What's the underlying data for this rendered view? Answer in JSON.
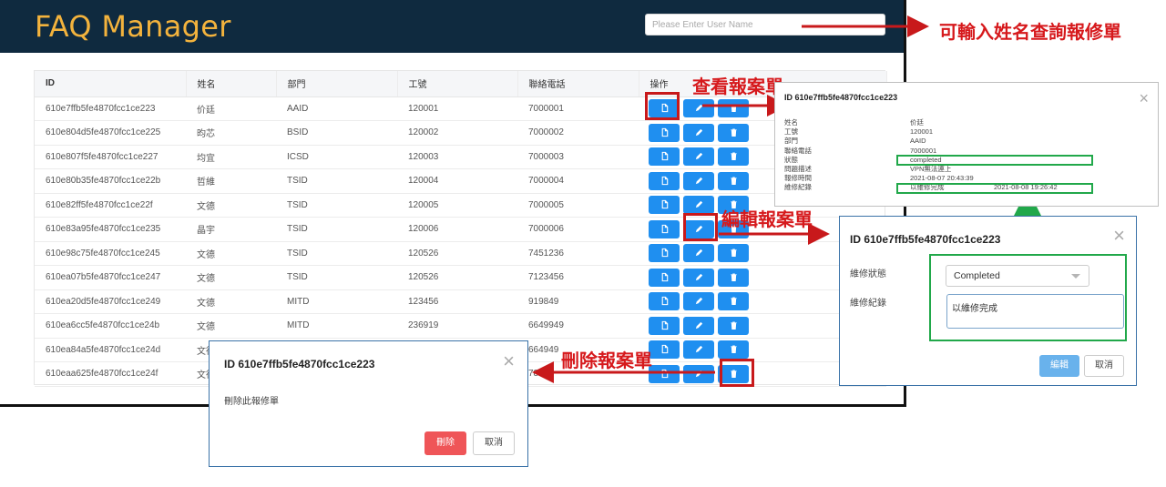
{
  "app": {
    "title": "FAQ Manager"
  },
  "search": {
    "placeholder": "Please Enter User Name"
  },
  "table": {
    "headers": [
      "ID",
      "姓名",
      "部門",
      "工號",
      "聯絡電話",
      "操作"
    ],
    "rows": [
      {
        "id": "610e7ffb5fe4870fcc1ce223",
        "name": "价廷",
        "dept": "AAID",
        "emp_no": "120001",
        "phone": "7000001"
      },
      {
        "id": "610e804d5fe4870fcc1ce225",
        "name": "昀芯",
        "dept": "BSID",
        "emp_no": "120002",
        "phone": "7000002"
      },
      {
        "id": "610e807f5fe4870fcc1ce227",
        "name": "均宜",
        "dept": "ICSD",
        "emp_no": "120003",
        "phone": "7000003"
      },
      {
        "id": "610e80b35fe4870fcc1ce22b",
        "name": "哲維",
        "dept": "TSID",
        "emp_no": "120004",
        "phone": "7000004"
      },
      {
        "id": "610e82ff5fe4870fcc1ce22f",
        "name": "文德",
        "dept": "TSID",
        "emp_no": "120005",
        "phone": "7000005"
      },
      {
        "id": "610e83a95fe4870fcc1ce235",
        "name": "晶宇",
        "dept": "TSID",
        "emp_no": "120006",
        "phone": "7000006"
      },
      {
        "id": "610e98c75fe4870fcc1ce245",
        "name": "文德",
        "dept": "TSID",
        "emp_no": "120526",
        "phone": "7451236"
      },
      {
        "id": "610ea07b5fe4870fcc1ce247",
        "name": "文德",
        "dept": "TSID",
        "emp_no": "120526",
        "phone": "7123456"
      },
      {
        "id": "610ea20d5fe4870fcc1ce249",
        "name": "文德",
        "dept": "MITD",
        "emp_no": "123456",
        "phone": "919849"
      },
      {
        "id": "610ea6cc5fe4870fcc1ce24b",
        "name": "文德",
        "dept": "MITD",
        "emp_no": "236919",
        "phone": "6649949"
      },
      {
        "id": "610ea84a5fe4870fcc1ce24d",
        "name": "文德",
        "dept": "",
        "emp_no": "",
        "phone": "664949"
      },
      {
        "id": "610eaa625fe4870fcc1ce24f",
        "name": "文德",
        "dept": "",
        "emp_no": "",
        "phone": "78466"
      }
    ]
  },
  "annotations": {
    "search_hint": "可輸入姓名查詢報修單",
    "view": "查看報案單",
    "edit": "編輯報案單",
    "delete": "刪除報案單"
  },
  "view_dialog": {
    "title": "ID 610e7ffb5fe4870fcc1ce223",
    "fields": [
      {
        "label": "姓名",
        "value": "价廷"
      },
      {
        "label": "工號",
        "value": "120001"
      },
      {
        "label": "部門",
        "value": "AAID"
      },
      {
        "label": "聯絡電話",
        "value": "7000001"
      },
      {
        "label": "狀態",
        "value": "completed"
      },
      {
        "label": "問題描述",
        "value": "VPN無法連上"
      },
      {
        "label": "報修時間",
        "value": "2021-08-07 20:43:39"
      },
      {
        "label": "維修紀錄",
        "value": "以維修完成"
      }
    ],
    "record_time": "2021-08-08 19:26:42"
  },
  "edit_dialog": {
    "title": "ID 610e7ffb5fe4870fcc1ce223",
    "status_label": "維修狀態",
    "status_value": "Completed",
    "record_label": "維修紀錄",
    "record_value": "以維修完成",
    "submit_label": "編輯",
    "cancel_label": "取消"
  },
  "delete_dialog": {
    "title": "ID 610e7ffb5fe4870fcc1ce223",
    "message": "刪除此報修單",
    "confirm_label": "刪除",
    "cancel_label": "取消"
  },
  "colors": {
    "header_bg": "#0f2a3f",
    "title": "#f3b33d",
    "primary_button": "#1f8ff0",
    "annotation_red": "#d6191c",
    "annotation_green": "#21a84a",
    "danger": "#ef5558"
  },
  "icons": {
    "view": "file-icon",
    "edit": "pencil-icon",
    "delete": "trash-icon",
    "close": "close-icon"
  }
}
